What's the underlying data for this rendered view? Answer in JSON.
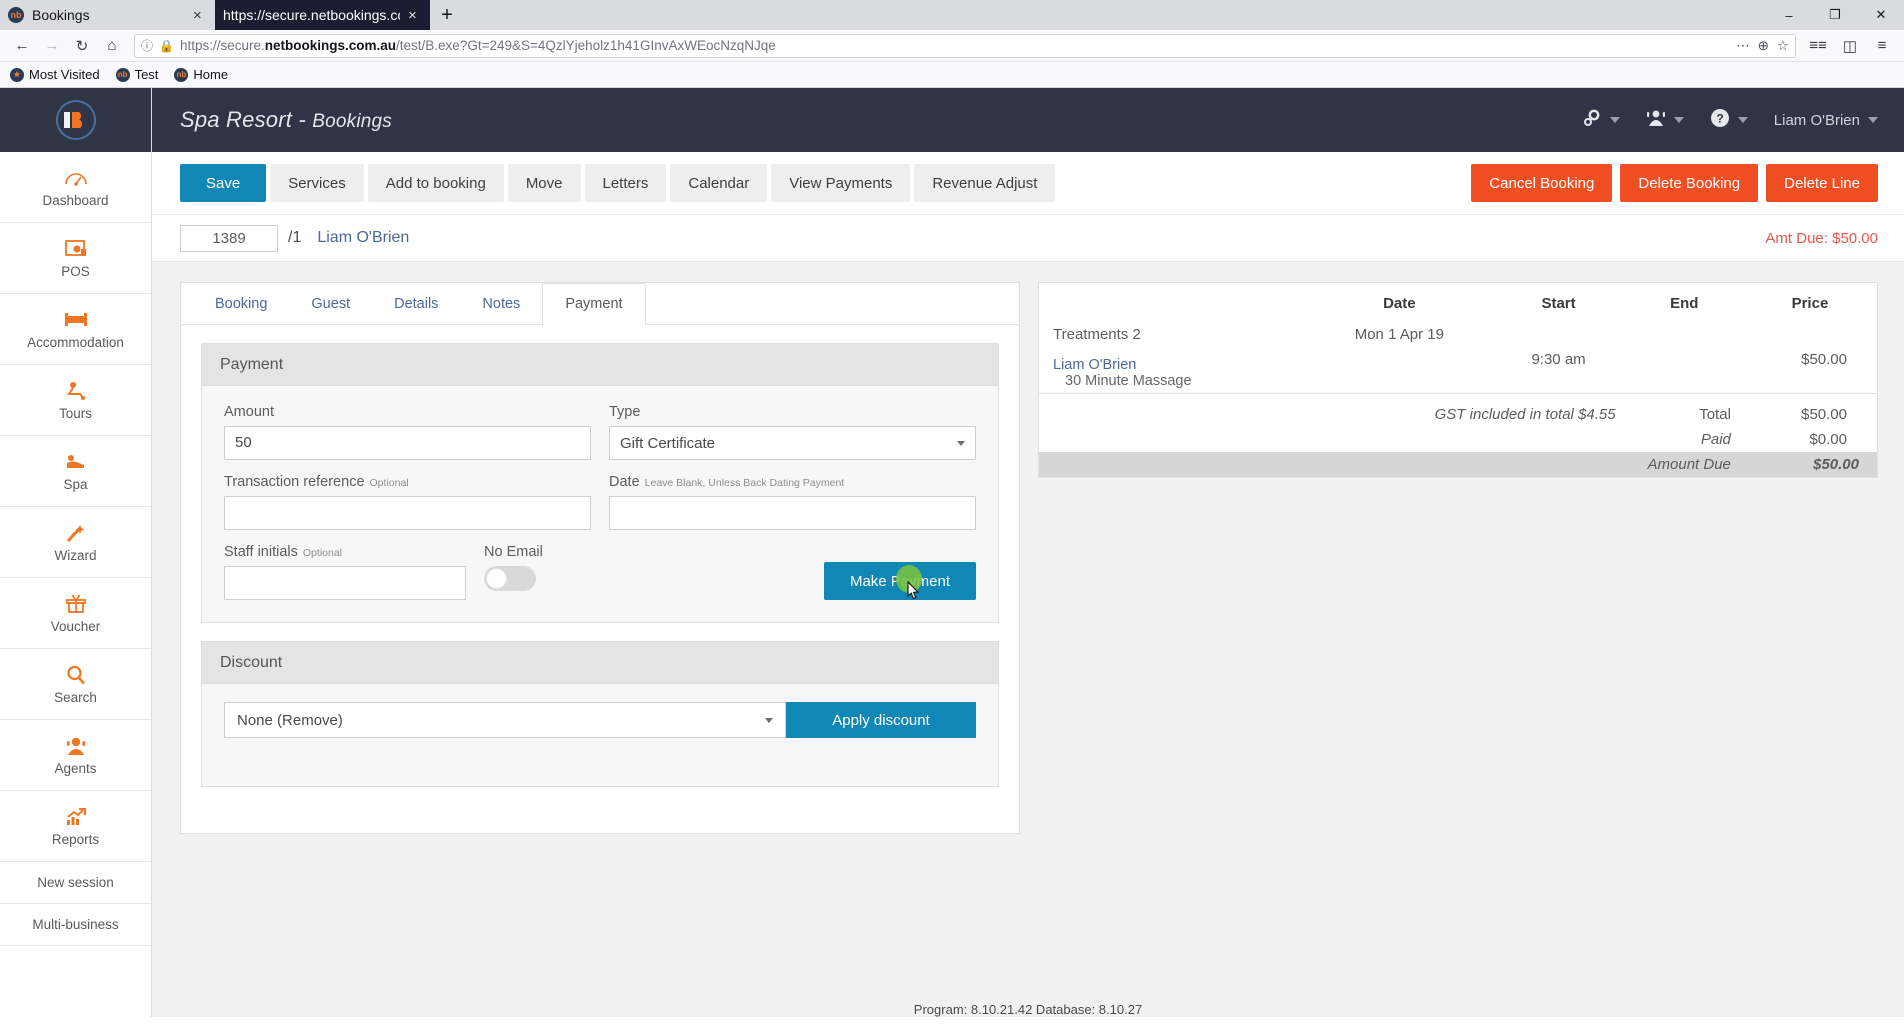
{
  "browser": {
    "tabs": [
      {
        "title": "Bookings",
        "active": false,
        "favicon": "nb-icon",
        "close": "×"
      },
      {
        "title": "https://secure.netbookings.com.au",
        "active": true,
        "favicon": "none",
        "close": "×"
      }
    ],
    "new_tab_label": "+",
    "window_buttons": [
      "–",
      "❐",
      "✕"
    ],
    "nav": {
      "back": "←",
      "forward": "→",
      "reload": "↻",
      "home": "⌂",
      "site_info": "ⓘ",
      "lock": "▮",
      "url_prefix": "https://secure.",
      "url_domain": "netbookings.com.au",
      "url_path": "/test/B.exe?Gt=249&S=4QzlYjeholz1h41GInvAxWEocNzqNJqe",
      "menu_dots": "⋯",
      "save_to_pocket": "⊕",
      "bookmark_star": "☆",
      "library": "≡≡",
      "sidebars": "◫",
      "app_menu": "≡"
    },
    "bookmarks": [
      {
        "label": "Most Visited",
        "icon": "star-icon"
      },
      {
        "label": "Test",
        "icon": "nb-icon"
      },
      {
        "label": "Home",
        "icon": "nb-icon"
      }
    ]
  },
  "sidebar": {
    "logo_alt": "nb-logo",
    "items": [
      {
        "label": "Dashboard",
        "icon": "dashboard-icon"
      },
      {
        "label": "POS",
        "icon": "pos-icon"
      },
      {
        "label": "Accommodation",
        "icon": "bed-icon"
      },
      {
        "label": "Tours",
        "icon": "tours-icon"
      },
      {
        "label": "Spa",
        "icon": "spa-icon"
      },
      {
        "label": "Wizard",
        "icon": "wand-icon"
      },
      {
        "label": "Voucher",
        "icon": "gift-icon"
      },
      {
        "label": "Search",
        "icon": "magnifier-icon"
      },
      {
        "label": "Agents",
        "icon": "agent-icon"
      },
      {
        "label": "Reports",
        "icon": "chart-icon"
      }
    ],
    "text_items": [
      {
        "label": "New session"
      },
      {
        "label": "Multi-business"
      }
    ]
  },
  "header": {
    "business": "Spa Resort",
    "separator": " - ",
    "section": "Bookings",
    "settings_icon": "gear-icon",
    "user_switch_icon": "user-group-icon",
    "help_icon": "question-icon",
    "user_name": "Liam O'Brien"
  },
  "toolbar": {
    "buttons": [
      {
        "label": "Save",
        "style": "primary"
      },
      {
        "label": "Services",
        "style": "default"
      },
      {
        "label": "Add to booking",
        "style": "default"
      },
      {
        "label": "Move",
        "style": "default"
      },
      {
        "label": "Letters",
        "style": "default"
      },
      {
        "label": "Calendar",
        "style": "default"
      },
      {
        "label": "View Payments",
        "style": "default"
      },
      {
        "label": "Revenue Adjust",
        "style": "default"
      }
    ],
    "danger_buttons": [
      {
        "label": "Cancel Booking"
      },
      {
        "label": "Delete Booking"
      },
      {
        "label": "Delete Line"
      }
    ]
  },
  "idbar": {
    "booking_id": "1389",
    "line_suffix": "/1",
    "guest_name": "Liam O'Brien",
    "amount_due_label": "Amt Due: $50.00"
  },
  "tabs": {
    "items": [
      {
        "label": "Booking",
        "active": false
      },
      {
        "label": "Guest",
        "active": false
      },
      {
        "label": "Details",
        "active": false
      },
      {
        "label": "Notes",
        "active": false
      },
      {
        "label": "Payment",
        "active": true
      }
    ]
  },
  "payment": {
    "panel_title": "Payment",
    "amount_label": "Amount",
    "amount_value": "50",
    "type_label": "Type",
    "type_value": "Gift Certificate",
    "transaction_label": "Transaction reference",
    "transaction_hint": "Optional",
    "transaction_value": "",
    "date_label": "Date",
    "date_hint": "Leave Blank, Unless Back Dating Payment",
    "date_value": "",
    "staff_label": "Staff initials",
    "staff_hint": "Optional",
    "staff_value": "",
    "no_email_label": "No Email",
    "no_email_on": false,
    "make_payment_label": "Make Payment"
  },
  "discount": {
    "panel_title": "Discount",
    "selected": "None (Remove)",
    "apply_label": "Apply discount"
  },
  "summary": {
    "columns": [
      "",
      "Date",
      "Start",
      "End",
      "Price"
    ],
    "group": {
      "name": "Treatments 2",
      "date": "Mon 1 Apr 19"
    },
    "line": {
      "guest": "Liam O'Brien",
      "service": "30 Minute Massage",
      "start": "9:30 am",
      "end": "",
      "price": "$50.00"
    },
    "gst_note": "GST included in total $4.55",
    "total_label": "Total",
    "total_value": "$50.00",
    "paid_label": "Paid",
    "paid_value": "$0.00",
    "due_label": "Amount Due",
    "due_value": "$50.00"
  },
  "footer": {
    "version_text": "Program: 8.10.21.42 Database: 8.10.27"
  },
  "colors": {
    "accent_blue": "#1087b5",
    "accent_orange": "#ef7622",
    "danger_red": "#f04e23",
    "dark_nav": "#2f3545",
    "due_red": "#e8261c"
  }
}
